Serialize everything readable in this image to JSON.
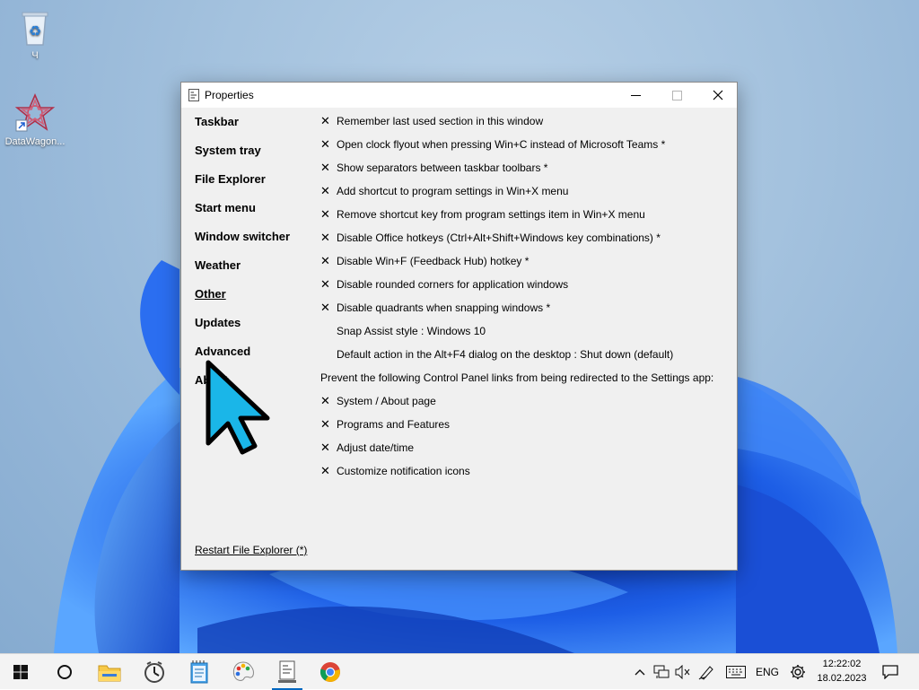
{
  "desktop": {
    "recycle_bin_label": "Ч",
    "datawagon_label": "DataWagon..."
  },
  "window": {
    "title": "Properties"
  },
  "nav": {
    "items": [
      {
        "label": "Taskbar"
      },
      {
        "label": "System tray"
      },
      {
        "label": "File Explorer"
      },
      {
        "label": "Start menu"
      },
      {
        "label": "Window switcher"
      },
      {
        "label": "Weather"
      },
      {
        "label": "Other",
        "active": true
      },
      {
        "label": "Updates"
      },
      {
        "label": "Advanced"
      },
      {
        "label": "About"
      }
    ]
  },
  "options": [
    {
      "mark": "✕",
      "text": "Remember last used section in this window"
    },
    {
      "mark": "✕",
      "text": "Open clock flyout when pressing Win+C instead of Microsoft Teams *"
    },
    {
      "mark": "✕",
      "text": "Show separators between taskbar toolbars *"
    },
    {
      "mark": "✕",
      "text": "Add shortcut to program settings in Win+X menu"
    },
    {
      "mark": "✕",
      "text": "Remove shortcut key from program settings item in Win+X menu"
    },
    {
      "mark": "✕",
      "text": "Disable Office hotkeys (Ctrl+Alt+Shift+Windows key combinations) *"
    },
    {
      "mark": "✕",
      "text": "Disable Win+F (Feedback Hub) hotkey *"
    },
    {
      "mark": "✕",
      "text": "Disable rounded corners for application windows"
    },
    {
      "mark": "✕",
      "text": "Disable quadrants when snapping windows *"
    },
    {
      "mark": "",
      "text": "Snap Assist style : Windows 10"
    },
    {
      "mark": "",
      "text": "Default action in the Alt+F4 dialog on the desktop : Shut down (default)"
    }
  ],
  "section": {
    "heading": "Prevent the following Control Panel links from being redirected to the Settings app:"
  },
  "redirect_options": [
    {
      "mark": "✕",
      "text": "System / About page"
    },
    {
      "mark": "✕",
      "text": "Programs and Features"
    },
    {
      "mark": "✕",
      "text": "Adjust date/time"
    },
    {
      "mark": "✕",
      "text": "Customize notification icons"
    }
  ],
  "footer": {
    "restart_link": "Restart File Explorer (*)"
  },
  "taskbar": {
    "language": "ENG",
    "time": "12:22:02",
    "date": "18.02.2023"
  },
  "colors": {
    "accent": "#0067c0",
    "bloom_blue": "#1f5fe0",
    "cursor_fill": "#1ab6e8"
  }
}
